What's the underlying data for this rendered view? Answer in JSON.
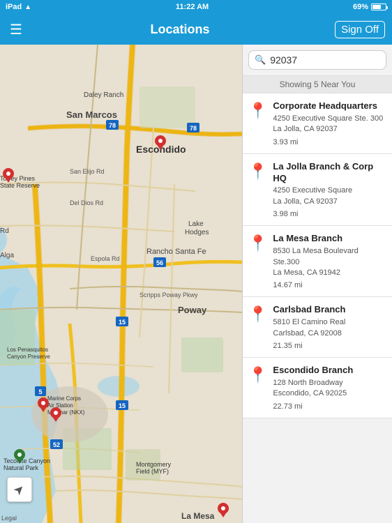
{
  "statusBar": {
    "carrier": "iPad",
    "time": "11:22 AM",
    "battery": "69%",
    "wifiLabel": "WiFi"
  },
  "navBar": {
    "title": "Locations",
    "signOffLabel": "Sign Off",
    "menuIcon": "☰"
  },
  "search": {
    "value": "92037",
    "placeholder": "92037"
  },
  "showingLabel": "Showing 5 Near You",
  "locations": [
    {
      "name": "Corporate Headquarters",
      "address": "4250 Executive Square Ste. 300\nLa Jolla, CA 92037",
      "distance": "3.93 mi"
    },
    {
      "name": "La Jolla Branch & Corp HQ",
      "address": "4250 Executive Square\nLa Jolla, CA 92037",
      "distance": "3.98 mi"
    },
    {
      "name": "La Mesa Branch",
      "address": "8530 La Mesa Boulevard Ste.300\nLa Mesa, CA 91942",
      "distance": "14.67 mi"
    },
    {
      "name": "Carlsbad Branch",
      "address": "5810 El Camino Real\nCarlsbad, CA 92008",
      "distance": "21.35 mi"
    },
    {
      "name": "Escondido Branch",
      "address": "128 North Broadway\nEscondido, CA 92025",
      "distance": "22.73 mi"
    }
  ],
  "map": {
    "compassSymbol": "➤",
    "legalText": "Legal"
  }
}
